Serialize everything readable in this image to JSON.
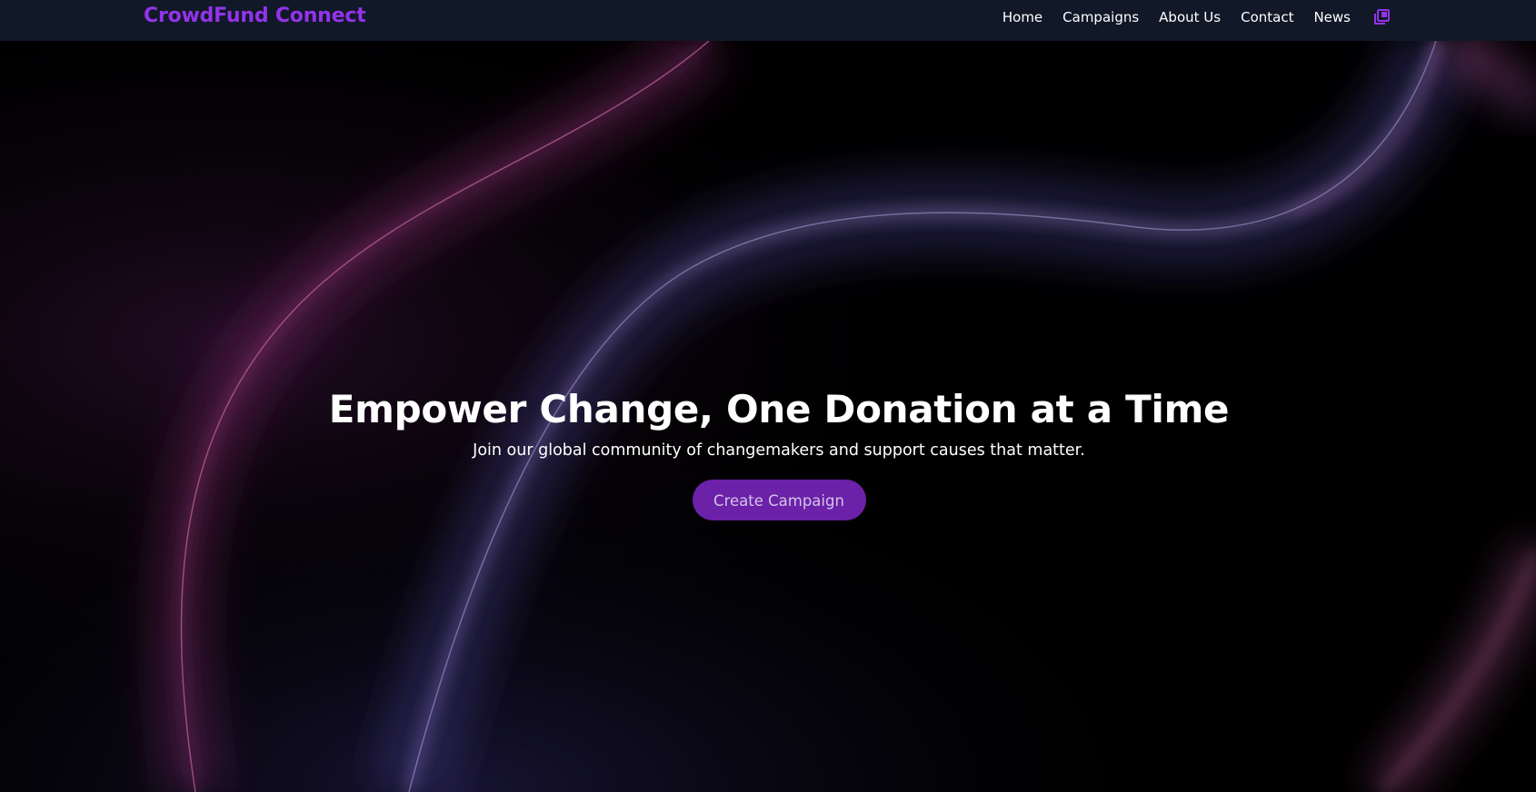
{
  "header": {
    "brand": "CrowdFund Connect",
    "nav": [
      {
        "label": "Home"
      },
      {
        "label": "Campaigns"
      },
      {
        "label": "About Us"
      },
      {
        "label": "Contact"
      },
      {
        "label": "News"
      }
    ],
    "icon": "copy-icon"
  },
  "hero": {
    "title": "Empower Change, One Donation at a Time",
    "subtitle": "Join our global community of changemakers and support causes that matter.",
    "cta_label": "Create Campaign"
  },
  "colors": {
    "navbar_bg": "#111827",
    "brand": "#9333ea",
    "button": "#6b21a8",
    "background": "#000000"
  }
}
